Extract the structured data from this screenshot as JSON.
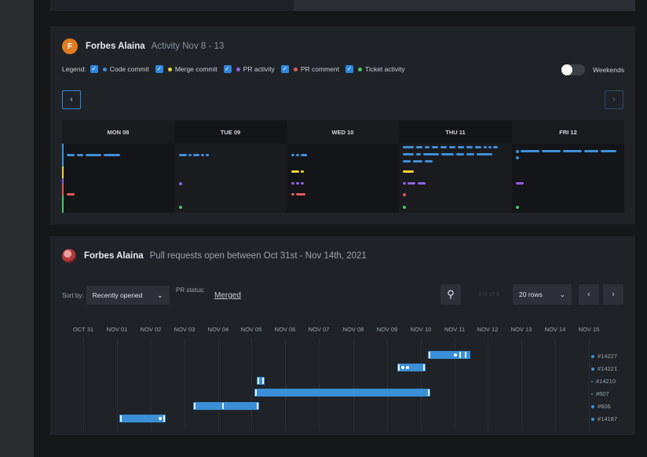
{
  "activity": {
    "avatar_letter": "F",
    "user": "Forbes Alaina",
    "subtitle": "Activity Nov 8 - 13",
    "legend_label": "Legend:",
    "legend": [
      {
        "label": "Code commit",
        "color": "#3f8fd8"
      },
      {
        "label": "Merge commit",
        "color": "#f0d23a"
      },
      {
        "label": "PR activity",
        "color": "#8d63e0"
      },
      {
        "label": "PR comment",
        "color": "#e05a5a"
      },
      {
        "label": "Ticket activity",
        "color": "#4cc36b"
      }
    ],
    "weekends_label": "Weekends",
    "prev_icon": "‹",
    "next_icon": "›",
    "days": [
      "MON 08",
      "TUE 09",
      "WED 10",
      "THU 11",
      "FRI 12"
    ]
  },
  "prs": {
    "user": "Forbes Alaina",
    "subtitle": "Pull requests open between Oct 31st - Nov 14th, 2021",
    "sort_label": "Sort by:",
    "sort_value": "Recently opened",
    "status_label": "PR status:",
    "status_value": "Merged",
    "count": "1-6 of 6",
    "rows_value": "20 rows",
    "dates": [
      "OCT 31",
      "NOV 01",
      "NOV 02",
      "NOV 03",
      "NOV 04",
      "NOV 05",
      "NOV 06",
      "NOV 07",
      "NOV 08",
      "NOV 09",
      "NOV 10",
      "NOV 11",
      "NOV 12",
      "NOV 13",
      "NOV 14",
      "NOV 15"
    ],
    "pr_ids": [
      "#14227",
      "#14221",
      "#14210",
      "#607",
      "#606",
      "#14187"
    ]
  }
}
